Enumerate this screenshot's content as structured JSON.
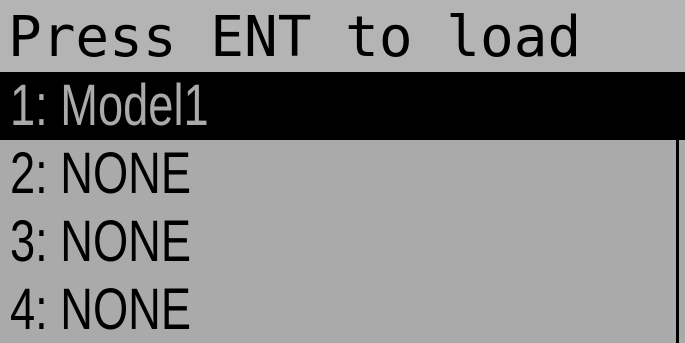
{
  "header": {
    "title": "Press ENT to load"
  },
  "model_list": {
    "items": [
      {
        "label": "1: Model1",
        "selected": true
      },
      {
        "label": "2: NONE",
        "selected": false
      },
      {
        "label": "3: NONE",
        "selected": false
      },
      {
        "label": "4: NONE",
        "selected": false
      }
    ]
  },
  "colors": {
    "background": "#aaaaaa",
    "header_background": "#b4b4b4",
    "foreground": "#000000",
    "selection": "#000000"
  }
}
